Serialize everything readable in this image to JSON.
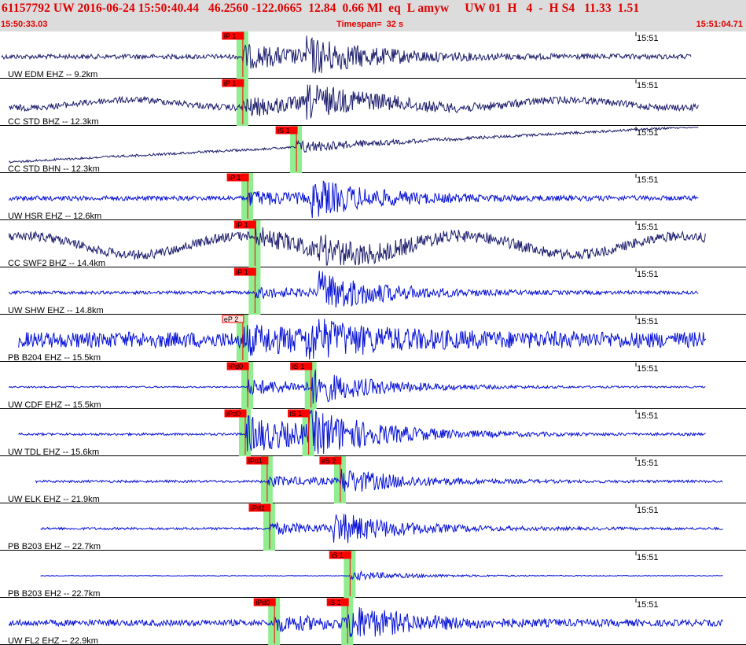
{
  "header": {
    "line": "61157792 UW 2016-06-24 15:50:40.44   46.2560 -122.0665  12.84  0.66 Ml  eq  L amyw     UW 01  H   4  -  H S4   11.33  1.51",
    "start_time": "15:50:33.03",
    "timespan": "Timespan=  32 s",
    "end_time": "15:51:04.71"
  },
  "colors": {
    "header_text": "#e00000",
    "header_bg": "#dcdcdc",
    "trace_blue": "#0a14d6",
    "trace_dark": "#1e1e6e",
    "window_green": "#90ee90",
    "pick_red": "#ff0000"
  },
  "tick_label": "15:51",
  "channels": [
    {
      "label": "UW EDM EHZ -- 9.2km",
      "color": "dark",
      "p_label": "iP 1",
      "p_time": 9.9,
      "p_style": "filled",
      "s_label": "",
      "s_time": null,
      "s_style": "",
      "noise": 3,
      "p_amp": 14,
      "s_amp": 18,
      "drift": 0,
      "start": 0.0,
      "end": 28.3
    },
    {
      "label": "CC STD BHZ -- 12.3km",
      "color": "dark",
      "p_label": "iP 1",
      "p_time": 9.9,
      "p_style": "filled",
      "s_label": "",
      "s_time": null,
      "s_style": "",
      "noise": 4,
      "p_amp": 10,
      "s_amp": 16,
      "drift": 5,
      "start": 0.3,
      "end": 28.6
    },
    {
      "label": "CC STD BHN -- 12.3km",
      "color": "dark",
      "p_label": "",
      "p_time": null,
      "p_style": "",
      "s_label": "iS 1",
      "s_time": 12.1,
      "s_style": "filled",
      "noise": 1.5,
      "p_amp": 3,
      "s_amp": 8,
      "drift": 0,
      "start": 0.3,
      "end": 28.6
    },
    {
      "label": "UW HSR EHZ -- 12.6km",
      "color": "blue",
      "p_label": "iP 1",
      "p_time": 10.1,
      "p_style": "filled",
      "s_label": "",
      "s_time": null,
      "s_style": "",
      "noise": 3,
      "p_amp": 8,
      "s_amp": 20,
      "drift": 0,
      "start": 0.3,
      "end": 28.6
    },
    {
      "label": "CC SWF2 BHZ -- 14.4km",
      "color": "dark",
      "p_label": "iP 1",
      "p_time": 10.4,
      "p_style": "filled",
      "s_label": "",
      "s_time": null,
      "s_style": "",
      "noise": 6,
      "p_amp": 8,
      "s_amp": 14,
      "drift": 12,
      "start": 0.3,
      "end": 28.9
    },
    {
      "label": "UW SHW EHZ -- 14.8km",
      "color": "blue",
      "p_label": "iP 1",
      "p_time": 10.4,
      "p_style": "filled",
      "s_label": "",
      "s_time": null,
      "s_style": "",
      "noise": 2,
      "p_amp": 6,
      "s_amp": 24,
      "drift": 0,
      "start": 0.3,
      "end": 28.6
    },
    {
      "label": "PB B204 EHZ -- 15.5km",
      "color": "blue",
      "p_label": "eP 2",
      "p_time": 9.9,
      "p_style": "outline",
      "s_label": "",
      "s_time": null,
      "s_style": "",
      "noise": 10,
      "p_amp": 12,
      "s_amp": 16,
      "drift": 0,
      "start": 0.7,
      "end": 28.9
    },
    {
      "label": "UW CDF EHZ -- 15.5km",
      "color": "blue",
      "p_label": "iPd0",
      "p_time": 10.1,
      "p_style": "filled",
      "s_label": "iS 1",
      "s_time": 12.7,
      "s_style": "filled",
      "noise": 1,
      "p_amp": 10,
      "s_amp": 18,
      "drift": 0,
      "start": 0.3,
      "end": 28.9
    },
    {
      "label": "UW TDL EHZ -- 15.6km",
      "color": "blue",
      "p_label": "iPd0",
      "p_time": 10.0,
      "p_style": "filled",
      "s_label": "iS 1",
      "s_time": 12.6,
      "s_style": "filled",
      "noise": 1.5,
      "p_amp": 24,
      "s_amp": 22,
      "drift": 0,
      "start": 0.7,
      "end": 28.9
    },
    {
      "label": "UW ELK EHZ -- 21.9km",
      "color": "blue",
      "p_label": "iPd1",
      "p_time": 10.9,
      "p_style": "filled",
      "s_label": "eS 2",
      "s_time": 13.9,
      "s_style": "filled",
      "noise": 1.5,
      "p_amp": 6,
      "s_amp": 14,
      "drift": 0,
      "start": 1.4,
      "end": 29.6
    },
    {
      "label": "PB B203 EHZ -- 22.7km",
      "color": "blue",
      "p_label": "iPd1",
      "p_time": 11.0,
      "p_style": "filled",
      "s_label": "",
      "s_time": null,
      "s_style": "",
      "noise": 1.5,
      "p_amp": 7,
      "s_amp": 18,
      "drift": 0,
      "start": 1.6,
      "end": 29.6
    },
    {
      "label": "PB B203 EH2 -- 22.7km",
      "color": "blue",
      "p_label": "",
      "p_time": null,
      "p_style": "",
      "s_label": "iS 1",
      "s_time": 14.3,
      "s_style": "filled",
      "noise": 0.4,
      "p_amp": 1,
      "s_amp": 6,
      "drift": 0,
      "start": 1.6,
      "end": 29.6
    },
    {
      "label": "UW FL2 EHZ -- 22.9km",
      "color": "blue",
      "p_label": "iPd0",
      "p_time": 11.2,
      "p_style": "filled",
      "s_label": "iS 1",
      "s_time": 14.2,
      "s_style": "filled",
      "noise": 4,
      "p_amp": 8,
      "s_amp": 18,
      "drift": 0,
      "start": 0.3,
      "end": 29.6
    }
  ]
}
